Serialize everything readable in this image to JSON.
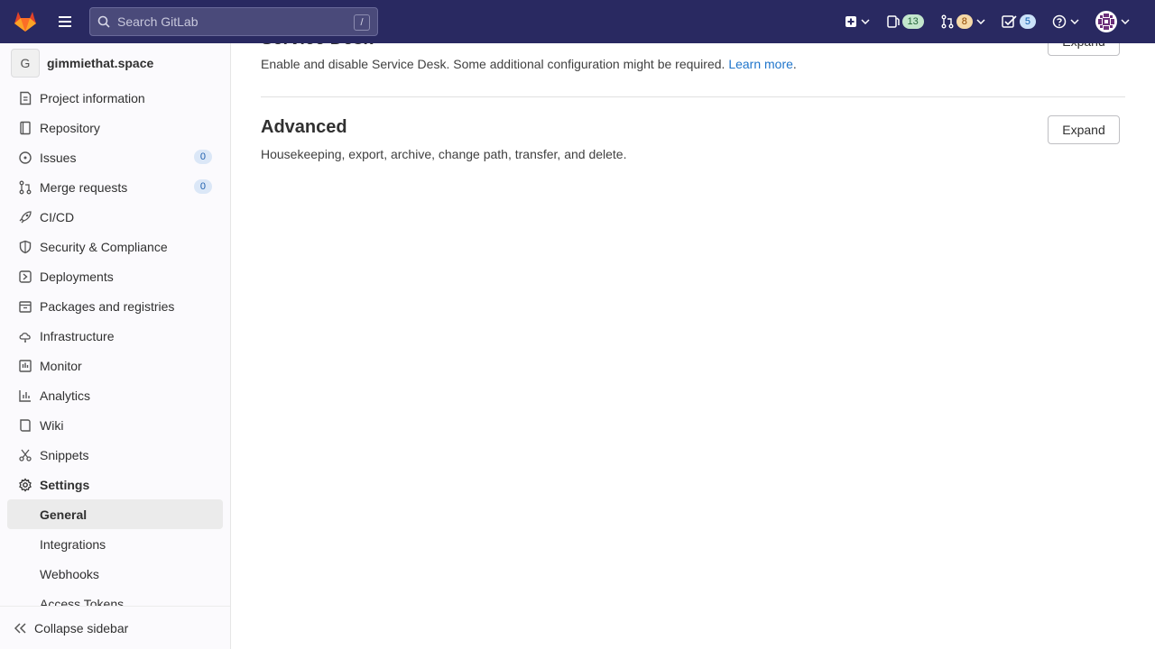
{
  "header": {
    "search_placeholder": "Search GitLab",
    "search_shortcut": "/",
    "issues_count": "13",
    "merge_requests_count": "8",
    "todos_count": "5"
  },
  "sidebar": {
    "project_initial": "G",
    "project_name": "gimmiethat.space",
    "items": [
      {
        "label": "Project information",
        "icon": "info-icon"
      },
      {
        "label": "Repository",
        "icon": "book-icon"
      },
      {
        "label": "Issues",
        "icon": "issues-icon",
        "count": "0"
      },
      {
        "label": "Merge requests",
        "icon": "merge-request-icon",
        "count": "0"
      },
      {
        "label": "CI/CD",
        "icon": "rocket-icon"
      },
      {
        "label": "Security & Compliance",
        "icon": "shield-icon"
      },
      {
        "label": "Deployments",
        "icon": "deployments-icon"
      },
      {
        "label": "Packages and registries",
        "icon": "package-icon"
      },
      {
        "label": "Infrastructure",
        "icon": "cloud-icon"
      },
      {
        "label": "Monitor",
        "icon": "monitor-icon"
      },
      {
        "label": "Analytics",
        "icon": "chart-icon"
      },
      {
        "label": "Wiki",
        "icon": "wiki-icon"
      },
      {
        "label": "Snippets",
        "icon": "scissors-icon"
      },
      {
        "label": "Settings",
        "icon": "gear-icon"
      }
    ],
    "settings_sub": [
      {
        "label": "General",
        "active": true
      },
      {
        "label": "Integrations"
      },
      {
        "label": "Webhooks"
      },
      {
        "label": "Access Tokens"
      }
    ],
    "collapse_label": "Collapse sidebar"
  },
  "main": {
    "service_desk": {
      "title": "Service Desk",
      "description": "Enable and disable Service Desk. Some additional configuration might be required.",
      "link": "Learn more",
      "link_suffix": ".",
      "button": "Expand"
    },
    "advanced": {
      "title": "Advanced",
      "description": "Housekeeping, export, archive, change path, transfer, and delete.",
      "button": "Expand"
    }
  },
  "colors": {
    "header_bg": "#292961",
    "sidebar_bg": "#fbfafd",
    "link": "#1f75cb",
    "active_bg": "#ebebeb"
  }
}
